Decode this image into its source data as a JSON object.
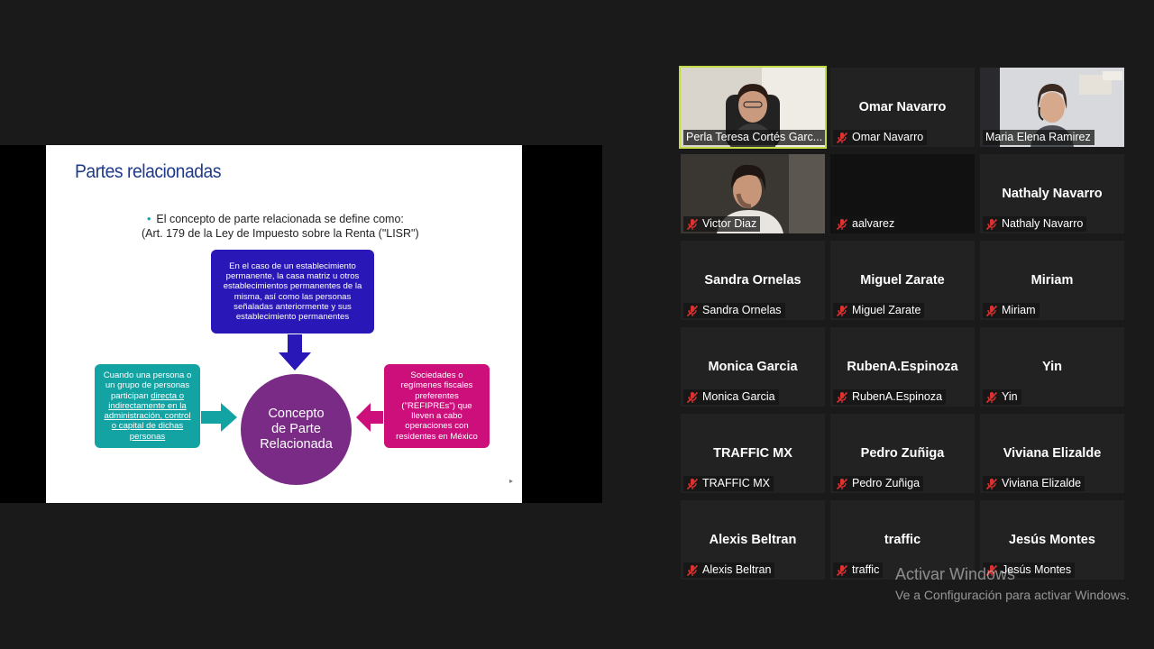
{
  "slide": {
    "title": "Partes relacionadas",
    "bullet": "El concepto de parte relacionada se define como:",
    "reference": "(Art. 179 de la Ley de Impuesto sobre la Renta (\"LISR\")",
    "box_top": [
      "En el caso de un establecimiento",
      "permanente, la casa matriz u otros",
      "establecimientos permanentes de la",
      "misma, así como las personas",
      "señaladas anteriormente y sus",
      "establecimiento permanentes"
    ],
    "box_left_plain": [
      "Cuando una persona o",
      "un grupo de personas",
      "participan "
    ],
    "box_left_underlined": [
      "directa o",
      "indirectamente en la",
      "administración, control",
      "o capital de dichas",
      "personas"
    ],
    "box_right": [
      "Sociedades o",
      "regímenes fiscales",
      "preferentes",
      "(\"REFIPREs\") que",
      "lleven a cabo",
      "operaciones con",
      "residentes en México"
    ],
    "center": [
      "Concepto",
      "de Parte",
      "Relacionada"
    ],
    "colors": {
      "top": "#2a17b8",
      "left": "#14a3a3",
      "right": "#cc0f7a",
      "center": "#7a2b86",
      "title": "#1f3a8a"
    }
  },
  "participants": [
    {
      "name": "Perla Teresa Cortés Garc...",
      "display": "",
      "video": true,
      "muted": false,
      "active": true
    },
    {
      "name": "Omar Navarro",
      "display": "Omar Navarro",
      "video": false,
      "muted": true
    },
    {
      "name": "Maria Elena Ramirez",
      "display": "",
      "video": true,
      "muted": false
    },
    {
      "name": "Victor Diaz",
      "display": "",
      "video": true,
      "muted": true
    },
    {
      "name": "aalvarez",
      "display": "",
      "video": false,
      "muted": true,
      "dark": true
    },
    {
      "name": "Nathaly Navarro",
      "display": "Nathaly Navarro",
      "video": false,
      "muted": true
    },
    {
      "name": "Sandra Ornelas",
      "display": "Sandra Ornelas",
      "video": false,
      "muted": true
    },
    {
      "name": "Miguel Zarate",
      "display": "Miguel Zarate",
      "video": false,
      "muted": true
    },
    {
      "name": "Miriam",
      "display": "Miriam",
      "video": false,
      "muted": true
    },
    {
      "name": "Monica Garcia",
      "display": "Monica Garcia",
      "video": false,
      "muted": true
    },
    {
      "name": "RubenA.Espinoza",
      "display": "RubenA.Espinoza",
      "video": false,
      "muted": true
    },
    {
      "name": "Yin",
      "display": "Yin",
      "video": false,
      "muted": true
    },
    {
      "name": "TRAFFIC MX",
      "display": "TRAFFIC MX",
      "video": false,
      "muted": true
    },
    {
      "name": "Pedro Zuñiga",
      "display": "Pedro Zuñiga",
      "video": false,
      "muted": true
    },
    {
      "name": "Viviana Elizalde",
      "display": "Viviana Elizalde",
      "video": false,
      "muted": true
    },
    {
      "name": "Alexis Beltran",
      "display": "Alexis Beltran",
      "video": false,
      "muted": true
    },
    {
      "name": "traffic",
      "display": "traffic",
      "video": false,
      "muted": true
    },
    {
      "name": "Jesús Montes",
      "display": "Jesús Montes",
      "video": false,
      "muted": true
    }
  ],
  "watermark": {
    "line1": "Activar Windows",
    "line2": "Ve a Configuración para activar Windows."
  },
  "icons": {
    "mute": "muted-microphone-icon"
  }
}
